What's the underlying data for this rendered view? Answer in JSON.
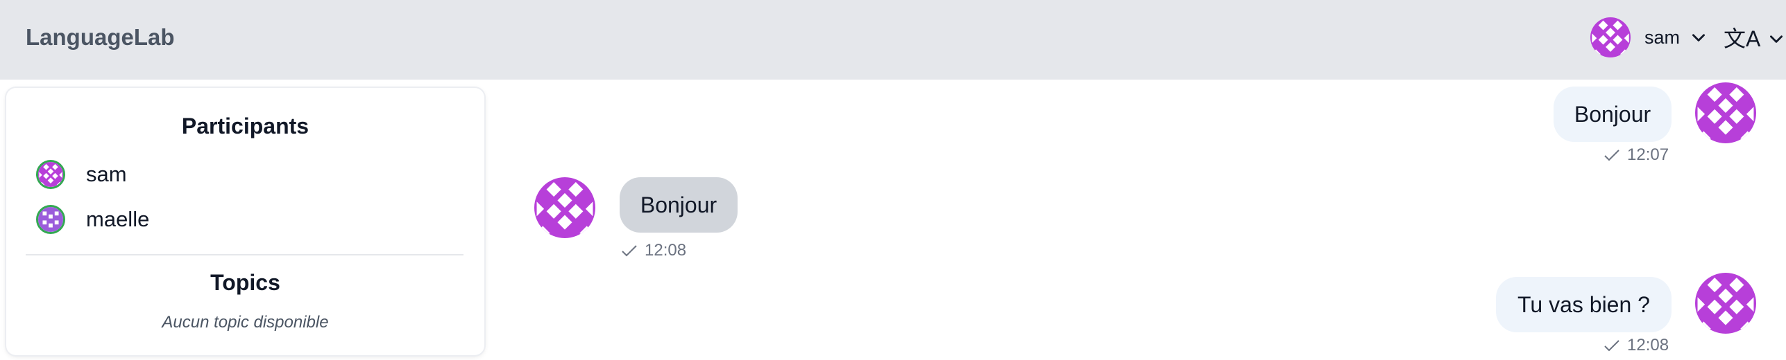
{
  "header": {
    "brand": "LanguageLab",
    "user": {
      "name": "sam",
      "avatar_icon": "identicon-avatar-icon"
    },
    "language_menu": {
      "icon": "translate-icon",
      "glyph": "文A"
    }
  },
  "sidebar": {
    "participants_title": "Participants",
    "participants": [
      {
        "name": "sam"
      },
      {
        "name": "maelle"
      }
    ],
    "topics_title": "Topics",
    "topics_empty": "Aucun topic disponible"
  },
  "messages": [
    {
      "text": "Bonjour",
      "time": "12:07",
      "mine": true,
      "status_icon": "check-icon"
    },
    {
      "text": "Bonjour",
      "time": "12:08",
      "mine": false,
      "status_icon": "check-icon"
    },
    {
      "text": "Tu vas bien ?",
      "time": "12:08",
      "mine": true,
      "status_icon": "check-icon"
    }
  ],
  "colors": {
    "header_bg": "#e5e7eb",
    "avatar_purple": "#b73fd9",
    "online_ring": "#34a853",
    "bubble_mine": "#eef4fb",
    "bubble_theirs": "#d1d5db"
  }
}
